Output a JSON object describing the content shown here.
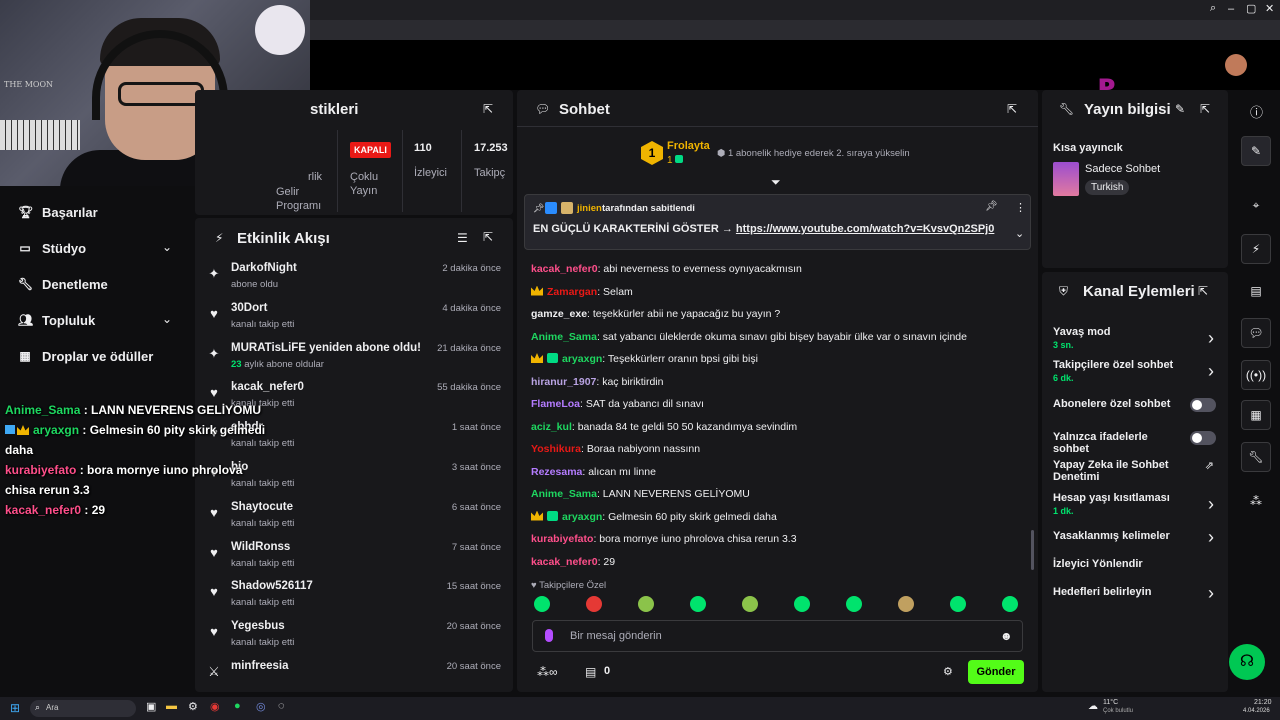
{
  "nav": {
    "items": [
      {
        "label": "Başarılar",
        "icon": "trophy-icon"
      },
      {
        "label": "Stüdyo",
        "icon": "studio-icon"
      },
      {
        "label": "Denetleme",
        "icon": "wrench-icon"
      },
      {
        "label": "Topluluk",
        "icon": "people-icon"
      },
      {
        "label": "Droplar ve ödüller",
        "icon": "gift-icon"
      }
    ]
  },
  "overlay_chat": [
    {
      "user": "Anime_Sama",
      "text": " : LANN NEVERENS GELİYOMU",
      "color": "#1ed760"
    },
    {
      "user": "aryaxgn",
      "text": " : Gelmesin 60 pity skirk gelmedi daha",
      "color": "#1ed760"
    },
    {
      "user": "kurabiyefato",
      "text": " : bora mornye iuno phrolova chisa rerun 3.3",
      "color": "#ff4f8b"
    },
    {
      "user": "kacak_nefer0",
      "text": " : 29",
      "color": "#ff4f8b"
    }
  ],
  "stats": {
    "title": "stikleri",
    "col0_label": "rlik",
    "col0b_label": "Gelir Programı",
    "offline_badge": "KAPALI",
    "multi_label": "Çoklu Yayın",
    "viewers_value": "110",
    "viewers_label": "İzleyici",
    "followers_value": "17.253",
    "followers_label": "Takipç"
  },
  "activity": {
    "title": "Etkinlik Akışı",
    "rows": [
      {
        "name": "DarkofNight",
        "sub": "abone oldu",
        "time": "2 dakika önce",
        "icon": "star-icon"
      },
      {
        "name": "30Dort",
        "sub": "kanalı takip etti",
        "time": "4 dakika önce",
        "icon": "heart-icon"
      },
      {
        "name": "MURATisLiFE yeniden abone oldu!",
        "sub_num": "23",
        "sub": " aylık abone oldular",
        "time": "21 dakika önce",
        "icon": "star-icon"
      },
      {
        "name": "kacak_nefer0",
        "sub": "kanalı takip etti",
        "time": "55 dakika önce",
        "icon": "heart-icon"
      },
      {
        "name": "ebhdr",
        "sub": "kanalı takip etti",
        "time": "1 saat önce",
        "icon": "heart-icon"
      },
      {
        "name": "bio",
        "sub": "kanalı takip etti",
        "time": "3 saat önce",
        "icon": "heart-icon"
      },
      {
        "name": "Shaytocute",
        "sub": "kanalı takip etti",
        "time": "6 saat önce",
        "icon": "heart-icon"
      },
      {
        "name": "WildRonss",
        "sub": "kanalı takip etti",
        "time": "7 saat önce",
        "icon": "heart-icon"
      },
      {
        "name": "Shadow526117",
        "sub": "kanalı takip etti",
        "time": "15 saat önce",
        "icon": "heart-icon"
      },
      {
        "name": "Yegesbus",
        "sub": "kanalı takip etti",
        "time": "20 saat önce",
        "icon": "heart-icon"
      },
      {
        "name": "minfreesia",
        "sub": "",
        "time": "20 saat önce",
        "icon": "sword-icon"
      }
    ]
  },
  "chat": {
    "title": "Sohbet",
    "gifter_name": "Frolayta",
    "gifter_rank": "1",
    "gifter_count": "1",
    "gift_hint": "1 abonelik hediye ederek 2. sıraya yükselin",
    "pinned_by_user": "jinien",
    "pinned_by_text": " tarafından sabitlendi",
    "pinned_text": "EN GÜÇLÜ KARAKTERİNİ GÖSTER → ",
    "pinned_link": "https://www.youtube.com/watch?v=KvsvQn2SPj0",
    "messages": [
      {
        "user": "kacak_nefer0",
        "text": ": abi neverness to everness oynıyacakmısın",
        "color": "#ff4f8b",
        "crown": false,
        "sub": false
      },
      {
        "user": "Zamargan",
        "text": ": Selam",
        "color": "#e91916",
        "crown": true,
        "sub": false
      },
      {
        "user": "gamze_exe",
        "text": ": teşekkürler abii ne yapacağız bu yayın ?",
        "color": "#efeff1",
        "crown": false,
        "sub": false
      },
      {
        "user": "Anime_Sama",
        "text": ": sat yabancı üleklerde okuma sınavı gibi bişey bayabir ülke var o sınavın içinde",
        "color": "#1ed760",
        "crown": false,
        "sub": false
      },
      {
        "user": "aryaxgn",
        "text": ": Teşekkürlerr oranın bpsi gibi bişi",
        "color": "#1ed760",
        "crown": true,
        "sub": true
      },
      {
        "user": "hiranur_1907",
        "text": ": kaç biriktirdin",
        "color": "#b9a3e3",
        "crown": false,
        "sub": false
      },
      {
        "user": "FlameLoa",
        "text": ": SAT da yabancı dil sınavı",
        "color": "#b47cff",
        "crown": false,
        "sub": false
      },
      {
        "user": "aciz_kul",
        "text": ": banada 84 te geldi 50 50 kazandımya sevindim",
        "color": "#1ed760",
        "crown": false,
        "sub": false
      },
      {
        "user": "Yoshikura",
        "text": ": Boraa nabiyonn nassınn",
        "color": "#e91916",
        "crown": false,
        "sub": false
      },
      {
        "user": "Rezesama",
        "text": ": alıcan mı linne",
        "color": "#b47cff",
        "crown": false,
        "sub": false
      },
      {
        "user": "Anime_Sama",
        "text": ": LANN NEVERENS GELİYOMU",
        "color": "#1ed760",
        "crown": false,
        "sub": false
      },
      {
        "user": "aryaxgn",
        "text": ": Gelmesin 60 pity skirk gelmedi daha",
        "color": "#1ed760",
        "crown": true,
        "sub": true
      },
      {
        "user": "kurabiyefato",
        "text": ": bora mornye iuno phrolova chisa rerun 3.3",
        "color": "#ff4f8b",
        "crown": false,
        "sub": false
      },
      {
        "user": "kacak_nefer0",
        "text": ": 29",
        "color": "#ff4f8b",
        "crown": false,
        "sub": false
      }
    ],
    "followers_only_label": "Takipçilere Özel",
    "input_placeholder": "Bir mesaj gönderin",
    "points_value": "0",
    "send_label": "Gönder"
  },
  "stream_info": {
    "title": "Yayın bilgisi",
    "short_label": "Kısa yayıncık",
    "category": "Sadece Sohbet",
    "tag": "Turkish"
  },
  "channel_actions": {
    "title": "Kanal Eylemleri",
    "items": [
      {
        "label": "Yavaş mod",
        "sub": "3 sn.",
        "type": "chevron"
      },
      {
        "label": "Takipçilere özel sohbet",
        "sub": "6 dk.",
        "type": "chevron"
      },
      {
        "label": "Abonelere özel sohbet",
        "sub": "",
        "type": "toggle"
      },
      {
        "label": "Yalnızca ifadelerle sohbet",
        "sub": "",
        "type": "toggle"
      },
      {
        "label": "Yapay Zeka ile Sohbet Denetimi",
        "sub": "",
        "type": "external"
      },
      {
        "label": "Hesap yaşı kısıtlaması",
        "sub": "1 dk.",
        "type": "chevron"
      },
      {
        "label": "Yasaklanmış kelimeler",
        "sub": "",
        "type": "chevron"
      },
      {
        "label": "İzleyici Yönlendir",
        "sub": "",
        "type": "none"
      },
      {
        "label": "Hedefleri belirleyin",
        "sub": "",
        "type": "chevron"
      }
    ]
  },
  "taskbar": {
    "search_label": "Ara",
    "weather_temp": "11°C",
    "weather_desc": "Çok bulutlu",
    "time": "21:20",
    "date": "4.04.2026"
  },
  "colors": {
    "accent": "#53fc18",
    "panel": "#18181b",
    "bg": "#0e0e10"
  }
}
